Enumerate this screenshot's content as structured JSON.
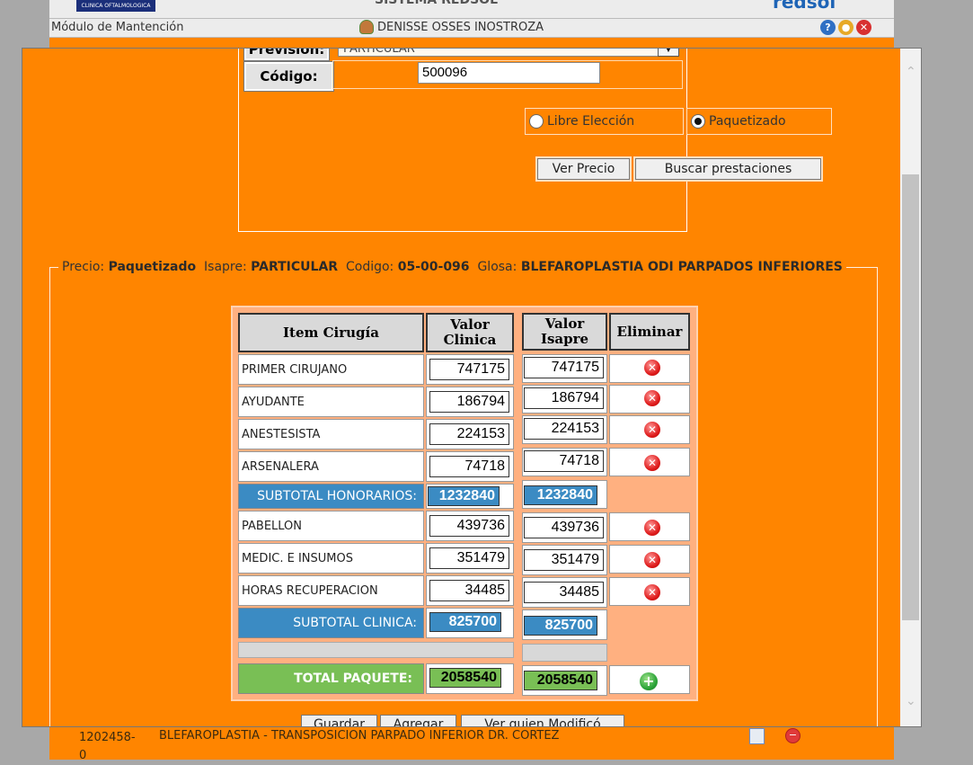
{
  "background": {
    "logo_text": "CLINICA OFTALMOLOGICA",
    "system_title": "SISTEMA REDSOL",
    "brand": "redsol",
    "module": "Módulo de Mantención",
    "user": "DENISSE OSSES INOSTROZA",
    "icons": [
      "help-icon",
      "lock-icon",
      "close-icon"
    ],
    "bottom_row": {
      "code": "1202458-0",
      "glosa": "BLEFAROPLASTIA - TRANSPOSICION PARPADO INFERIOR DR. CORTEZ"
    }
  },
  "search": {
    "prevision_label": "Previsión:",
    "prevision_value": "PARTICULAR",
    "codigo_label": "Código:",
    "codigo_value": "500096",
    "radio_libre": "Libre Elección",
    "radio_paquete": "Paquetizado",
    "selected_radio": "Paquetizado",
    "btn_ver_precio": "Ver Precio",
    "btn_buscar": "Buscar prestaciones"
  },
  "summary": {
    "precio_label": "Precio:",
    "precio_value": "Paquetizado",
    "isapre_label": "Isapre:",
    "isapre_value": "PARTICULAR",
    "codigo_label": "Codigo:",
    "codigo_value": "05-00-096",
    "glosa_label": "Glosa:",
    "glosa_value": "BLEFAROPLASTIA ODI PARPADOS INFERIORES"
  },
  "table": {
    "headers": {
      "item": "Item Cirugía",
      "valor_clinica": "Valor Clinica",
      "valor_isapre": "Valor Isapre",
      "eliminar": "Eliminar"
    },
    "honorarios": [
      {
        "item": "PRIMER CIRUJANO",
        "clinica": "747175",
        "isapre": "747175"
      },
      {
        "item": "AYUDANTE",
        "clinica": "186794",
        "isapre": "186794"
      },
      {
        "item": "ANESTESISTA",
        "clinica": "224153",
        "isapre": "224153"
      },
      {
        "item": "ARSENALERA",
        "clinica": "74718",
        "isapre": "74718"
      }
    ],
    "subtotal_honorarios": {
      "label": "SUBTOTAL HONORARIOS:",
      "clinica": "1232840",
      "isapre": "1232840"
    },
    "clinica_items": [
      {
        "item": "PABELLON",
        "clinica": "439736",
        "isapre": "439736"
      },
      {
        "item": "MEDIC. E INSUMOS",
        "clinica": "351479",
        "isapre": "351479"
      },
      {
        "item": "HORAS RECUPERACION",
        "clinica": "34485",
        "isapre": "34485"
      }
    ],
    "subtotal_clinica": {
      "label": "SUBTOTAL CLINICA:",
      "clinica": "825700",
      "isapre": "825700"
    },
    "total": {
      "label": "TOTAL PAQUETE:",
      "clinica": "2058540",
      "isapre": "2058540"
    },
    "delete_icon": "delete-icon",
    "add_icon": "add-icon"
  },
  "actions": {
    "guardar": "Guardar",
    "agregar": "Agregar",
    "ver_quien": "Ver quien Modificó"
  },
  "colors": {
    "accent": "#ff8500",
    "subtotal": "#3b8bc3",
    "total": "#79bf55"
  }
}
